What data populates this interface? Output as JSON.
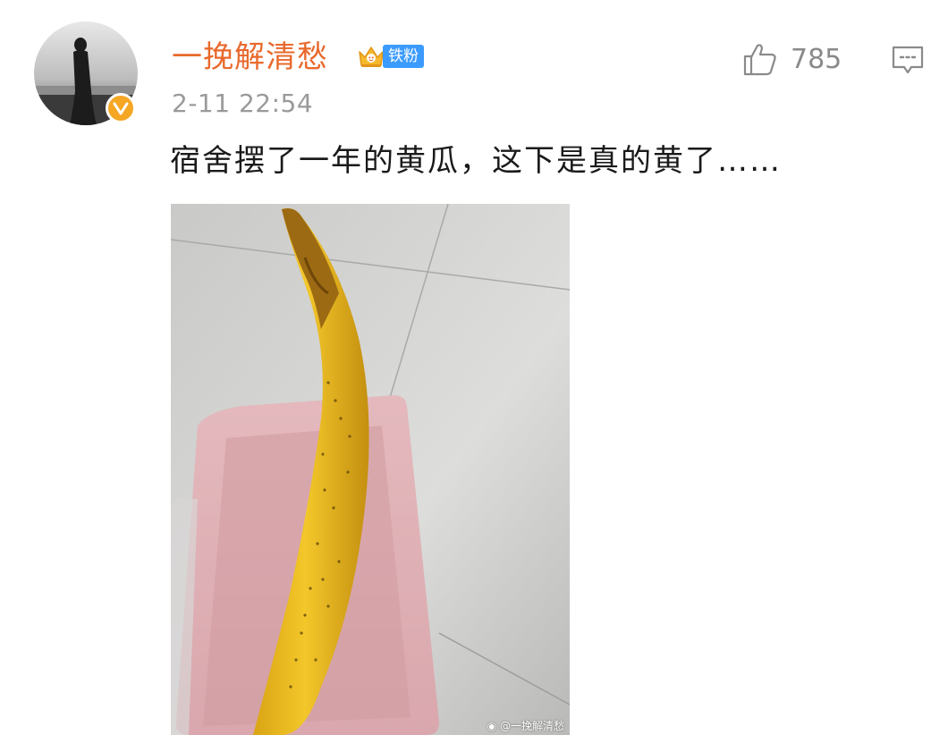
{
  "post": {
    "username": "一挽解清愁",
    "fan_badge": "铁粉",
    "timestamp": "2-11 22:54",
    "like_count": "785",
    "text": "宿舍摆了一年的黄瓜，这下是真的黄了……",
    "watermark": "@一挽解清愁"
  },
  "colors": {
    "username": "#e8692c",
    "verified_badge": "#f5a623",
    "fan_badge": "#3b9bff"
  },
  "icons": [
    "avatar-image",
    "verified-icon",
    "crown-icon",
    "thumbs-up-icon",
    "comment-icon",
    "weibo-logo-icon"
  ]
}
